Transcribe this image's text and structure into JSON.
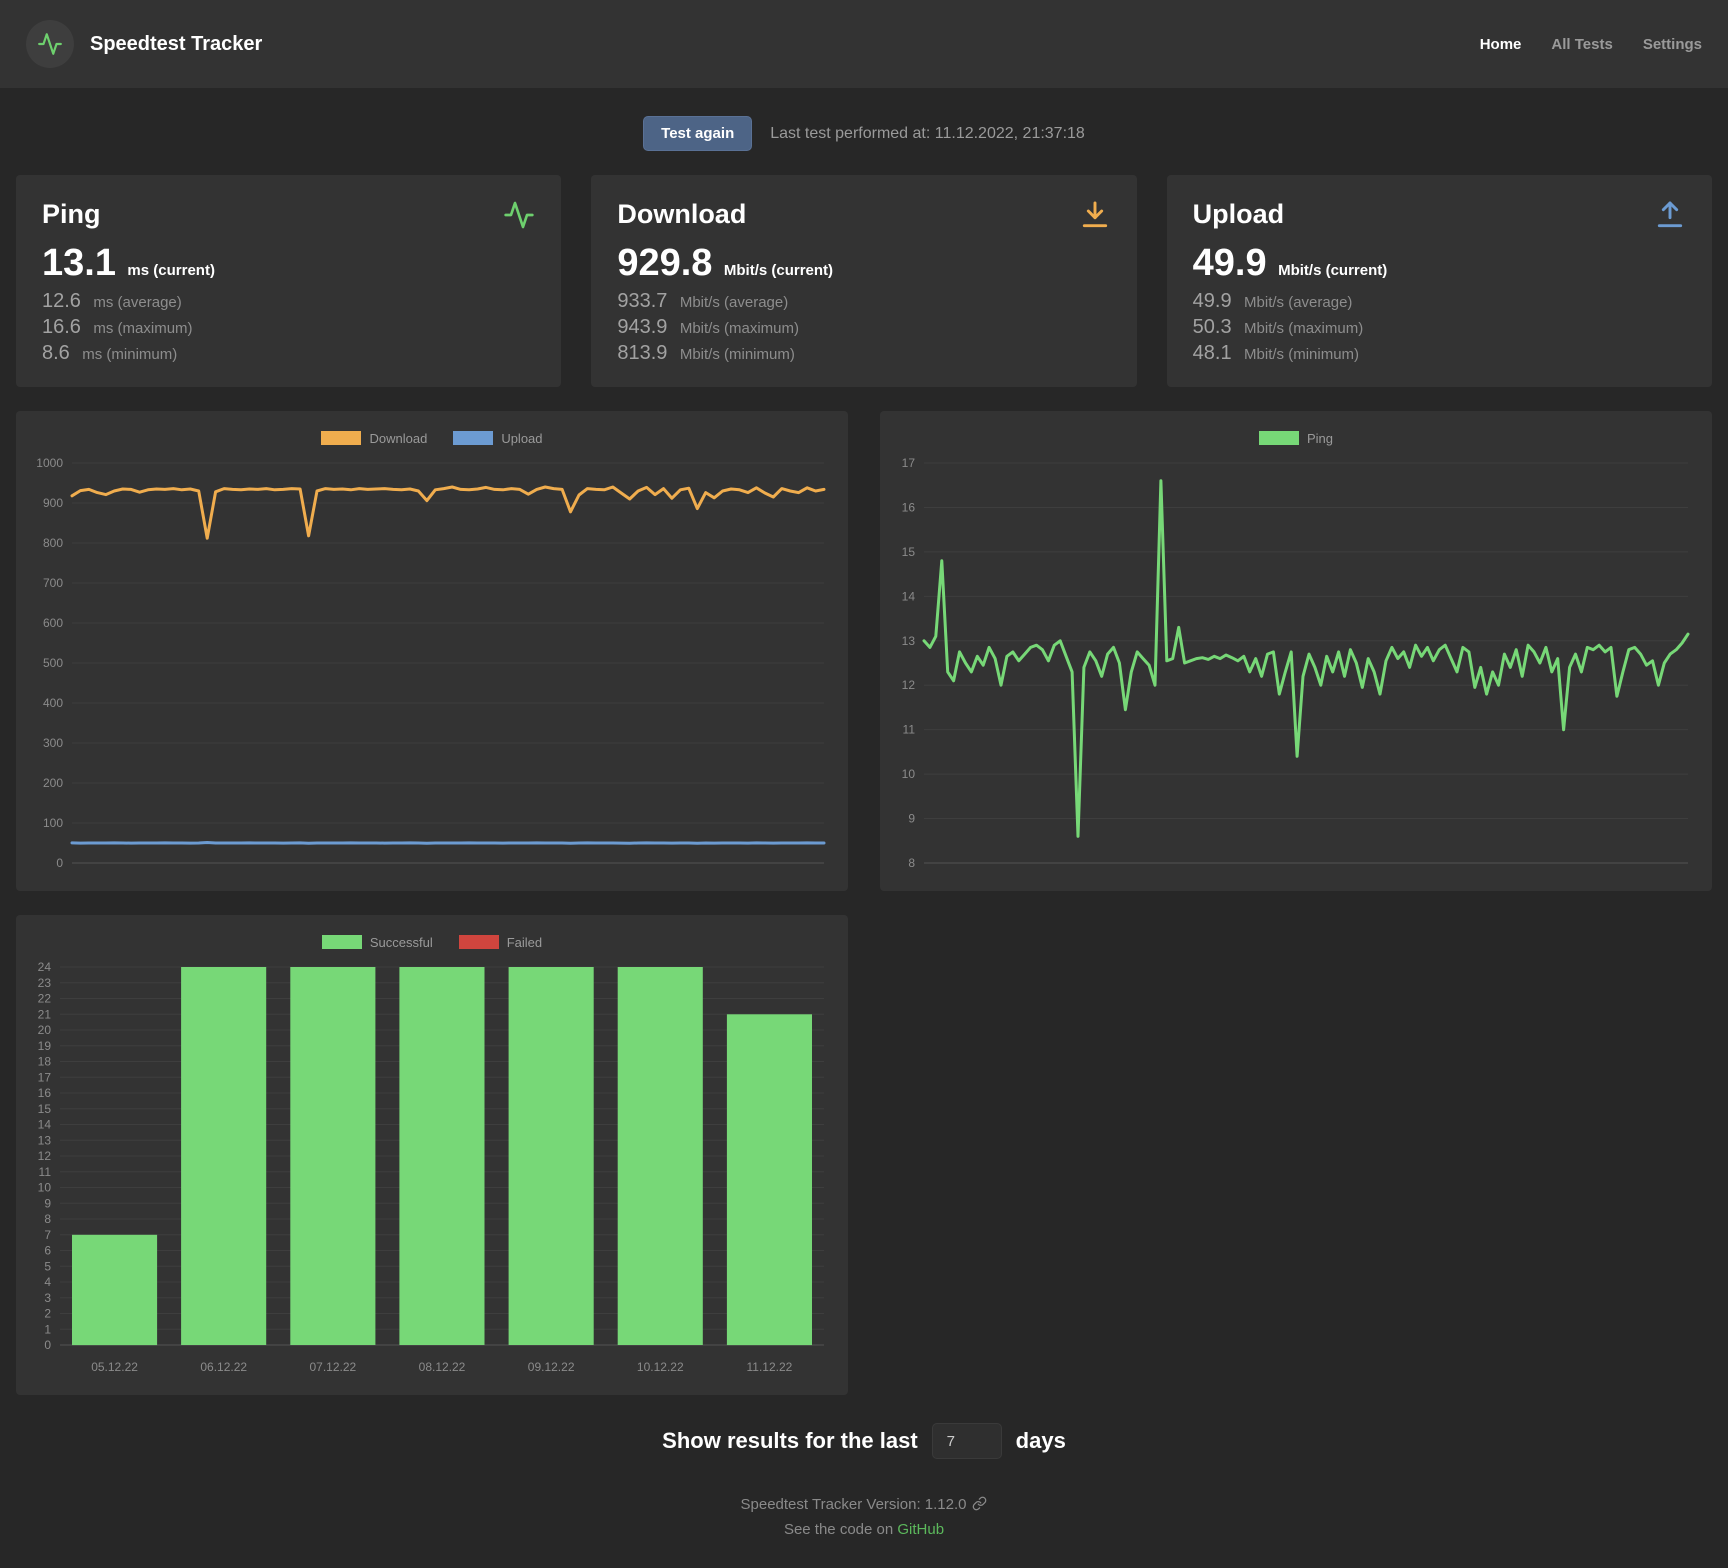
{
  "header": {
    "title": "Speedtest Tracker",
    "nav": [
      {
        "label": "Home",
        "active": true
      },
      {
        "label": "All Tests",
        "active": false
      },
      {
        "label": "Settings",
        "active": false
      }
    ]
  },
  "test_row": {
    "button_label": "Test again",
    "last_test_text": "Last test performed at: 11.12.2022, 21:37:18"
  },
  "cards": [
    {
      "title": "Ping",
      "icon": "activity-icon",
      "value": "13.1",
      "unit": "ms (current)",
      "rows": [
        {
          "value": "12.6",
          "label": "ms (average)"
        },
        {
          "value": "16.6",
          "label": "ms (maximum)"
        },
        {
          "value": "8.6",
          "label": "ms (minimum)"
        }
      ]
    },
    {
      "title": "Download",
      "icon": "download-icon",
      "value": "929.8",
      "unit": "Mbit/s (current)",
      "rows": [
        {
          "value": "933.7",
          "label": "Mbit/s (average)"
        },
        {
          "value": "943.9",
          "label": "Mbit/s (maximum)"
        },
        {
          "value": "813.9",
          "label": "Mbit/s (minimum)"
        }
      ]
    },
    {
      "title": "Upload",
      "icon": "upload-icon",
      "value": "49.9",
      "unit": "Mbit/s (current)",
      "rows": [
        {
          "value": "49.9",
          "label": "Mbit/s (average)"
        },
        {
          "value": "50.3",
          "label": "Mbit/s (maximum)"
        },
        {
          "value": "48.1",
          "label": "Mbit/s (minimum)"
        }
      ]
    }
  ],
  "show_results": {
    "prefix": "Show results for the last",
    "input_value": "7",
    "suffix": "days"
  },
  "footer": {
    "version_text": "Speedtest Tracker Version: 1.12.0",
    "see_code_prefix": "See the code on",
    "github_label": "GitHub"
  },
  "colors": {
    "page_bg": "#272727",
    "panel_bg": "#333333",
    "button_blue": "#4d6486",
    "download_orange": "#f0ad4e",
    "upload_blue": "#6c9bd2",
    "ping_green": "#77d877",
    "failed_red": "#d0453e",
    "github_green": "#5cb85c"
  },
  "chart_data": [
    {
      "id": "speed-chart",
      "type": "line",
      "title": "Download / Upload over time (Mbit/s)",
      "ylim": [
        0,
        1000
      ],
      "ytick_step": 100,
      "grid": true,
      "legend_position": "top",
      "legend": [
        {
          "label": "Download",
          "color": "#f0ad4e"
        },
        {
          "label": "Upload",
          "color": "#6c9bd2"
        }
      ],
      "series": [
        {
          "name": "Download",
          "color": "#f0ad4e",
          "values": [
            918,
            931,
            934,
            926,
            921,
            930,
            935,
            934,
            927,
            933,
            935,
            934,
            936,
            933,
            935,
            930,
            812,
            928,
            936,
            934,
            933,
            935,
            934,
            936,
            933,
            934,
            936,
            935,
            818,
            930,
            936,
            934,
            935,
            933,
            936,
            934,
            935,
            936,
            934,
            933,
            935,
            930,
            906,
            933,
            936,
            940,
            934,
            933,
            935,
            939,
            934,
            933,
            936,
            934,
            922,
            934,
            940,
            936,
            934,
            878,
            920,
            936,
            934,
            933,
            940,
            925,
            910,
            930,
            939,
            921,
            936,
            912,
            933,
            937,
            886,
            926,
            913,
            930,
            935,
            933,
            926,
            938,
            925,
            915,
            936,
            930,
            926,
            938,
            930,
            934
          ]
        },
        {
          "name": "Upload",
          "color": "#6c9bd2",
          "values": [
            50.2,
            49.8,
            50.1,
            50,
            49.9,
            50.3,
            50,
            49.8,
            50.1,
            50,
            49.9,
            50.2,
            50,
            50.1,
            49.8,
            50,
            51.3,
            50,
            49.9,
            50.1,
            50,
            50.2,
            49.9,
            50,
            50.1,
            49.8,
            50,
            50.2,
            49.6,
            50,
            50.1,
            49.9,
            50,
            50.2,
            49.9,
            50.1,
            50,
            49.8,
            50.1,
            50,
            50.2,
            49.9,
            49.6,
            50,
            50.1,
            49.9,
            50,
            50.2,
            49.9,
            50,
            50.1,
            49.8,
            50,
            50.1,
            49.9,
            50.2,
            50,
            49.9,
            50.1,
            49.5,
            50,
            50.2,
            49.9,
            50,
            50.1,
            49.8,
            49.6,
            50,
            50.2,
            49.9,
            50,
            49.7,
            50.1,
            50,
            49.5,
            49.9,
            49.7,
            50,
            50.1,
            49.9,
            49.8,
            50.2,
            49.9,
            49.7,
            50,
            50.1,
            49.9,
            50.2,
            50,
            50
          ]
        }
      ]
    },
    {
      "id": "ping-chart",
      "type": "line",
      "title": "Ping over time (ms)",
      "ylim": [
        8,
        17
      ],
      "ytick_step": 1,
      "grid": true,
      "legend_position": "top",
      "legend": [
        {
          "label": "Ping",
          "color": "#77d877"
        }
      ],
      "series": [
        {
          "name": "Ping",
          "color": "#77d877",
          "values": [
            13,
            12.85,
            13.1,
            14.8,
            12.3,
            12.1,
            12.75,
            12.5,
            12.3,
            12.65,
            12.45,
            12.85,
            12.6,
            12,
            12.65,
            12.75,
            12.55,
            12.7,
            12.85,
            12.9,
            12.8,
            12.55,
            12.9,
            13,
            12.65,
            12.3,
            8.6,
            12.4,
            12.75,
            12.55,
            12.2,
            12.7,
            12.85,
            12.5,
            11.45,
            12.3,
            12.75,
            12.6,
            12.45,
            12,
            16.6,
            12.55,
            12.6,
            13.3,
            12.5,
            12.55,
            12.6,
            12.62,
            12.58,
            12.65,
            12.6,
            12.68,
            12.62,
            12.55,
            12.65,
            12.3,
            12.6,
            12.2,
            12.7,
            12.75,
            11.8,
            12.3,
            12.75,
            10.4,
            12.2,
            12.7,
            12.4,
            12,
            12.65,
            12.3,
            12.75,
            12.2,
            12.8,
            12.5,
            11.95,
            12.6,
            12.3,
            11.8,
            12.55,
            12.85,
            12.6,
            12.75,
            12.4,
            12.9,
            12.65,
            12.85,
            12.55,
            12.8,
            12.9,
            12.6,
            12.3,
            12.85,
            12.75,
            11.95,
            12.4,
            11.8,
            12.3,
            12,
            12.7,
            12.4,
            12.8,
            12.2,
            12.9,
            12.75,
            12.5,
            12.85,
            12.3,
            12.6,
            11,
            12.4,
            12.7,
            12.3,
            12.85,
            12.8,
            12.9,
            12.75,
            12.85,
            11.75,
            12.3,
            12.8,
            12.85,
            12.7,
            12.45,
            12.55,
            12,
            12.5,
            12.7,
            12.8,
            12.95,
            13.15
          ]
        }
      ]
    },
    {
      "id": "tests-chart",
      "type": "bar",
      "title": "Tests per day",
      "ylim": [
        0,
        24
      ],
      "ytick_step": 1,
      "grid": true,
      "legend_position": "top",
      "categories": [
        "05.12.22",
        "06.12.22",
        "07.12.22",
        "08.12.22",
        "09.12.22",
        "10.12.22",
        "11.12.22"
      ],
      "legend": [
        {
          "label": "Successful",
          "color": "#77d877"
        },
        {
          "label": "Failed",
          "color": "#d0453e"
        }
      ],
      "series": [
        {
          "name": "Successful",
          "color": "#77d877",
          "values": [
            7,
            24,
            24,
            24,
            24,
            24,
            21
          ]
        },
        {
          "name": "Failed",
          "color": "#d0453e",
          "values": [
            0,
            0,
            0,
            0,
            0,
            0,
            0
          ]
        }
      ]
    }
  ]
}
